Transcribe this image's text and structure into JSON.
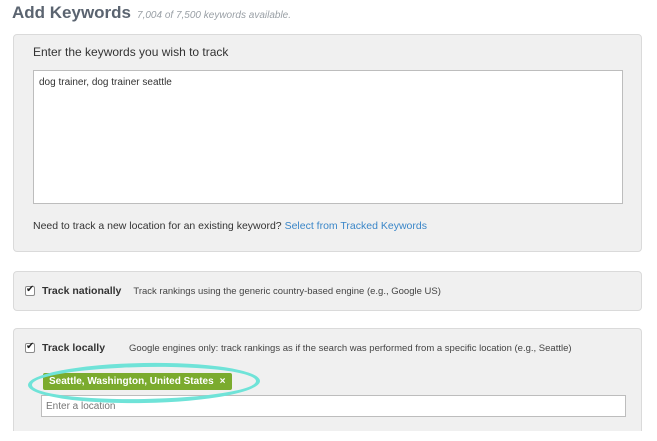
{
  "header": {
    "title": "Add Keywords",
    "subtitle": "7,004 of 7,500 keywords available."
  },
  "keywords_panel": {
    "label": "Enter the keywords you wish to track",
    "textarea_value": "dog trainer, dog trainer seattle",
    "help_text": "Need to track a new location for an existing keyword?",
    "help_link": "Select from Tracked Keywords"
  },
  "track_nationally": {
    "checked": true,
    "label": "Track nationally",
    "description": "Track rankings using the generic country-based engine (e.g., Google US)"
  },
  "track_locally": {
    "checked": true,
    "label": "Track locally",
    "description": "Google engines only: track rankings as if the search was performed from a specific location (e.g., Seattle)",
    "location_tag": "Seattle, Washington, United States",
    "tag_remove": "×",
    "input_placeholder": "Enter a location"
  },
  "colors": {
    "link": "#3a86c8",
    "tag_bg": "#7bab2e",
    "highlight": "#6fe3d8"
  },
  "icons": {
    "checkbox": "check-icon",
    "remove": "close-icon"
  }
}
